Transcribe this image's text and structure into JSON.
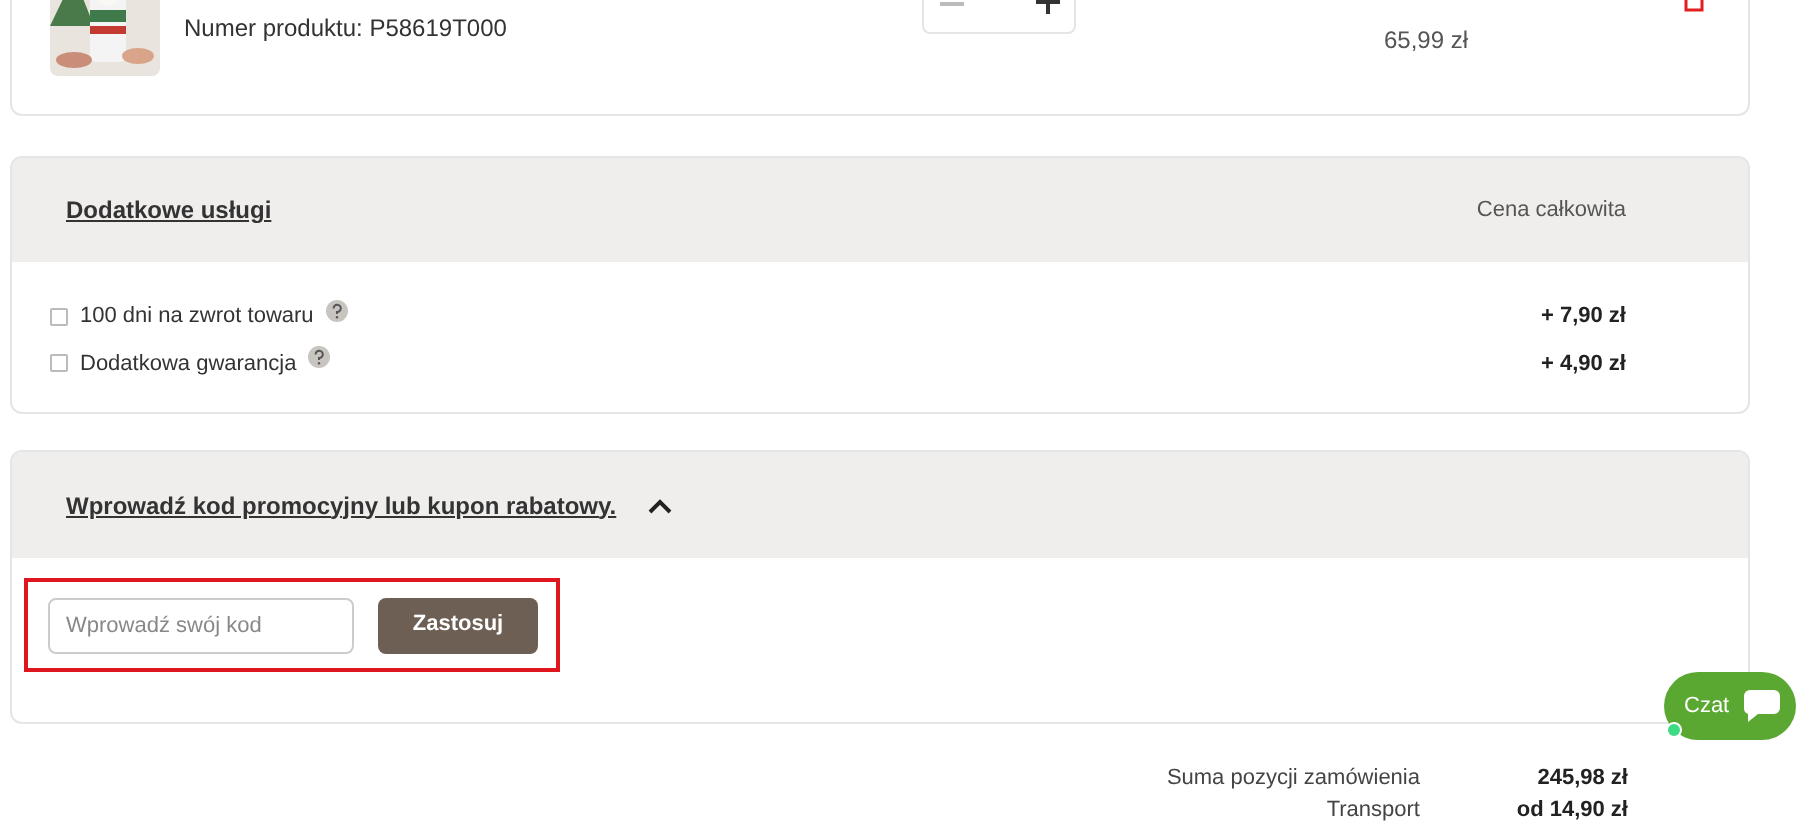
{
  "product": {
    "number": "Numer produktu: P58619T000",
    "price": "65,99 zł"
  },
  "services": {
    "title": "Dodatkowe usługi",
    "price_heading": "Cena całkowita",
    "items": [
      {
        "label": "100 dni na zwrot towaru",
        "checked": false,
        "price": "+ 7,90 zł"
      },
      {
        "label": "Dodatkowa gwarancja",
        "checked": false,
        "price": "+ 4,90 zł"
      }
    ]
  },
  "promo": {
    "title": "Wprowadź kod promocyjny lub kupon rabatowy.",
    "expanded": true,
    "placeholder": "Wprowadź swój kod",
    "button": "Zastosuj"
  },
  "summary": [
    {
      "label": "Suma pozycji zamówienia",
      "value": "245,98 zł"
    },
    {
      "label": "Transport",
      "value": "od 14,90 zł"
    }
  ],
  "chat": {
    "label": "Czat"
  }
}
